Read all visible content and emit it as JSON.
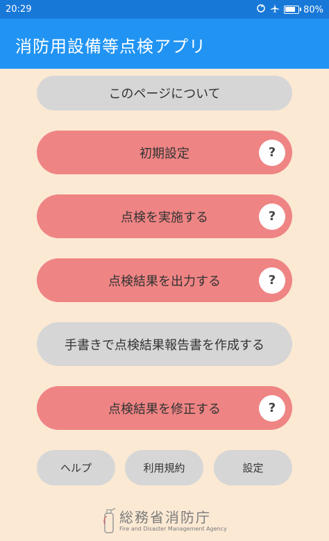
{
  "status_bar": {
    "time": "20:29",
    "battery": "80%",
    "battery_level": 0.8
  },
  "app_bar": {
    "title": "消防用設備等点検アプリ"
  },
  "buttons": {
    "about": "このページについて",
    "initial_settings": "初期設定",
    "perform_inspection": "点検を実施する",
    "output_results": "点検結果を出力する",
    "handwritten_report": "手書きで点検結果報告書を作成する",
    "modify_results": "点検結果を修正する"
  },
  "help_mark": "?",
  "bottom_buttons": {
    "help": "ヘルプ",
    "terms": "利用規約",
    "settings": "設定"
  },
  "footer": {
    "agency_name": "総務省消防庁",
    "agency_english": "Fire and Disaster Management Agency"
  },
  "colors": {
    "status_bar": "#1878d8",
    "app_bar": "#2194f3",
    "background": "#fbe9d4",
    "button_red": "#ef8484",
    "button_gray": "#d6d6d6"
  }
}
